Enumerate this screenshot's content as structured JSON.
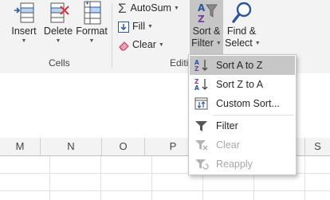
{
  "ribbon": {
    "insert": "Insert",
    "delete": "Delete",
    "format": "Format",
    "cells_group": "Cells",
    "editing_group": "Editi",
    "autosum": "AutoSum",
    "fill": "Fill",
    "clear": "Clear",
    "sort_filter_1": "Sort &",
    "sort_filter_2": "Filter",
    "find_select_1": "Find &",
    "find_select_2": "Select"
  },
  "columns": [
    "M",
    "N",
    "O",
    "P",
    "S"
  ],
  "menu": {
    "items": [
      {
        "label": "Sort A to Z",
        "icon": "sort-a-to-z-icon",
        "state": "highlighted"
      },
      {
        "label": "Sort Z to A",
        "icon": "sort-z-to-a-icon",
        "state": "enabled"
      },
      {
        "label": "Custom Sort...",
        "icon": "custom-sort-icon",
        "state": "enabled"
      },
      {
        "label": "Filter",
        "icon": "funnel-icon",
        "state": "enabled"
      },
      {
        "label": "Clear",
        "icon": "clear-filter-icon",
        "state": "disabled"
      },
      {
        "label": "Reapply",
        "icon": "reapply-filter-icon",
        "state": "disabled"
      }
    ]
  },
  "colors": {
    "accent": "#2b579a",
    "delete_red": "#d13438",
    "sort_purple": "#7b3f9e",
    "highlight": "#c6c6c6"
  }
}
